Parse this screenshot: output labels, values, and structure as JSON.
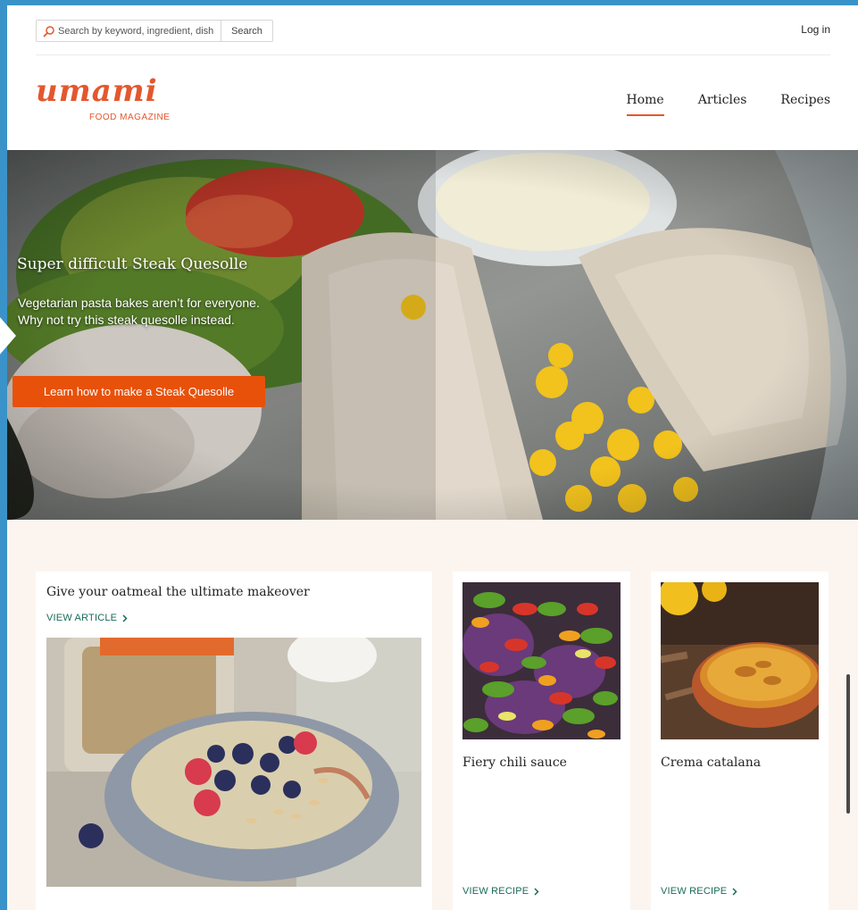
{
  "search": {
    "placeholder": "Search by keyword, ingredient, dish",
    "button_label": "Search"
  },
  "auth": {
    "login_label": "Log in"
  },
  "brand": {
    "name": "umami",
    "tagline": "FOOD MAGAZINE",
    "color": "#e4572e"
  },
  "nav": {
    "items": [
      {
        "label": "Home",
        "active": true
      },
      {
        "label": "Articles",
        "active": false
      },
      {
        "label": "Recipes",
        "active": false
      }
    ]
  },
  "hero": {
    "title": "Super difficult Steak Quesolle",
    "text_line1": "Vegetarian pasta bakes aren’t for everyone.",
    "text_line2": "Why not try this steak quesolle instead.",
    "cta_label": "Learn how to make a Steak Quesolle",
    "cta_color": "#e8510a"
  },
  "cards": {
    "feature": {
      "title": "Give your oatmeal the ultimate makeover",
      "link_label": "VIEW ARTICLE"
    },
    "chili": {
      "title": "Fiery chili sauce",
      "link_label": "VIEW RECIPE"
    },
    "crema": {
      "title": "Crema catalana",
      "link_label": "VIEW RECIPE"
    }
  },
  "icons": {
    "search": "search-icon",
    "chevron": "chevron-right-icon"
  }
}
